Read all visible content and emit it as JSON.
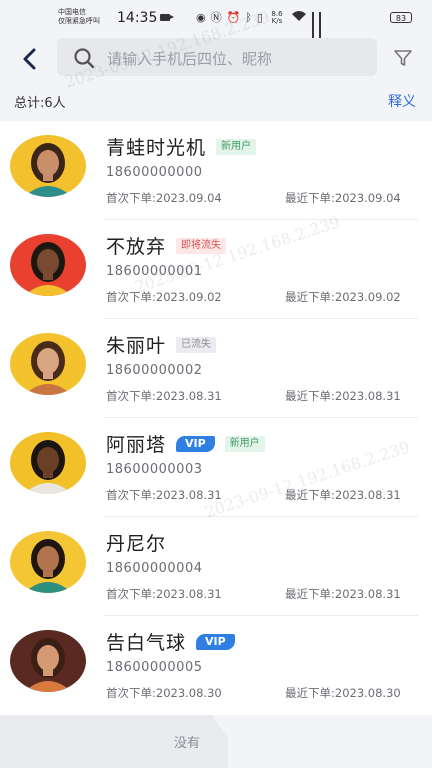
{
  "status_bar": {
    "carrier_line1": "中国电信",
    "carrier_line2": "仅限紧急呼叫",
    "time": "14:35",
    "net_speed": "8.6 K/s",
    "battery": "83"
  },
  "header": {
    "search_placeholder": "请输入手机后四位、昵称"
  },
  "summary": {
    "total": "总计:6人",
    "explain_link": "释义"
  },
  "customers": [
    {
      "name": "青蛙时光机",
      "tags": [
        {
          "text": "新用户",
          "kind": "new"
        }
      ],
      "phone": "18600000000",
      "first_order": "首次下单:2023.09.04",
      "recent_order": "最近下单:2023.09.04",
      "avatar_bg": "#f4c12e",
      "skin": "#c98f6a",
      "hair": "#3b2418",
      "shirt": "#2f8e8a"
    },
    {
      "name": "不放弃",
      "tags": [
        {
          "text": "即将流失",
          "kind": "soon"
        }
      ],
      "phone": "18600000001",
      "first_order": "首次下单:2023.09.02",
      "recent_order": "最近下单:2023.09.02",
      "avatar_bg": "#e9402f",
      "skin": "#7a4a30",
      "hair": "#1d1712",
      "shirt": "#f2c12b"
    },
    {
      "name": "朱丽叶",
      "tags": [
        {
          "text": "已流失",
          "kind": "lost"
        }
      ],
      "phone": "18600000002",
      "first_order": "首次下单:2023.08.31",
      "recent_order": "最近下单:2023.08.31",
      "avatar_bg": "#f3c22c",
      "skin": "#d8a582",
      "hair": "#4a2b1a",
      "shirt": "#c9753f"
    },
    {
      "name": "阿丽塔",
      "tags": [
        {
          "text": "VIP",
          "kind": "vip"
        },
        {
          "text": "新用户",
          "kind": "new"
        }
      ],
      "phone": "18600000003",
      "first_order": "首次下单:2023.08.31",
      "recent_order": "最近下单:2023.08.31",
      "avatar_bg": "#f2c12a",
      "skin": "#6b3f28",
      "hair": "#1b1411",
      "shirt": "#e9e6e2"
    },
    {
      "name": "丹尼尔",
      "tags": [],
      "phone": "18600000004",
      "first_order": "首次下单:2023.08.31",
      "recent_order": "最近下单:2023.08.31",
      "avatar_bg": "#f4c633",
      "skin": "#b0754e",
      "hair": "#20160f",
      "shirt": "#2f8f7e"
    },
    {
      "name": "告白气球",
      "tags": [
        {
          "text": "VIP",
          "kind": "vip"
        }
      ],
      "phone": "18600000005",
      "first_order": "首次下单:2023.08.30",
      "recent_order": "最近下单:2023.08.30",
      "avatar_bg": "#5a2a22",
      "skin": "#d59a73",
      "hair": "#3a1f14",
      "shirt": "#d97a3e"
    }
  ],
  "footer": {
    "label": "没有"
  },
  "watermark": "2023-09-12 192.168.2.239"
}
